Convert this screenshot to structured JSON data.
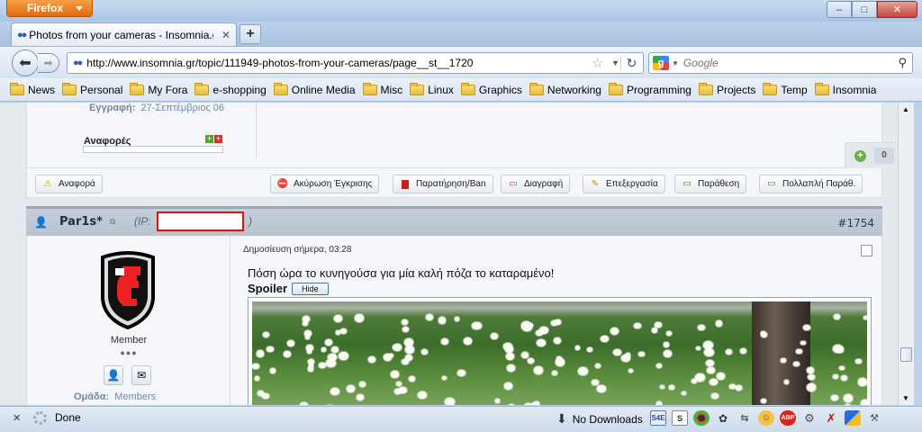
{
  "browser": {
    "menu_button": "Firefox",
    "window_controls": {
      "minimize": "–",
      "maximize": "□",
      "close": "✕"
    },
    "tab": {
      "title": "Photos from your cameras - Insomnia.gr"
    },
    "url": "http://www.insomnia.gr/topic/111949-photos-from-your-cameras/page__st__1720",
    "search": {
      "engine": "Google",
      "placeholder": "Google"
    },
    "bookmarks": [
      "News",
      "Personal",
      "My Fora",
      "e-shopping",
      "Online Media",
      "Misc",
      "Linux",
      "Graphics",
      "Networking",
      "Programming",
      "Projects",
      "Temp",
      "Insomnia"
    ]
  },
  "prev_post": {
    "registration_label": "Εγγραφή:",
    "registration_date": "27-Σεπτέμβριος 06",
    "reports_label": "Αναφορές",
    "rep_count": "0"
  },
  "actions": {
    "report": "Αναφορά",
    "cancel_approval": "Ακύρωση Έγκρισης",
    "warn_ban": "Παρατήρηση/Ban",
    "delete": "Διαγραφή",
    "edit": "Επεξεργασία",
    "quote": "Παράθεση",
    "multiquote": "Πολλαπλή Παράθ."
  },
  "post": {
    "author": "Par1s*",
    "ip_label": "(IP:",
    "ip_close": ")",
    "post_number": "#1754",
    "role": "Member",
    "pips": "●●●",
    "group_label": "Ομάδα:",
    "group_value": "Members",
    "posted": "Δημοσίευση σήμερα, 03:28",
    "message": "Πόση ώρα το κυνηγούσα για μία καλή πόζα το καταραμένο!",
    "spoiler_label": "Spoiler",
    "hide_button": "Hide"
  },
  "status": {
    "text": "Done",
    "downloads": "No Downloads"
  },
  "colors": {
    "firefox_orange": "#e06a10",
    "ip_redaction_border": "#e01010",
    "post_header": "#b7c3d0"
  }
}
